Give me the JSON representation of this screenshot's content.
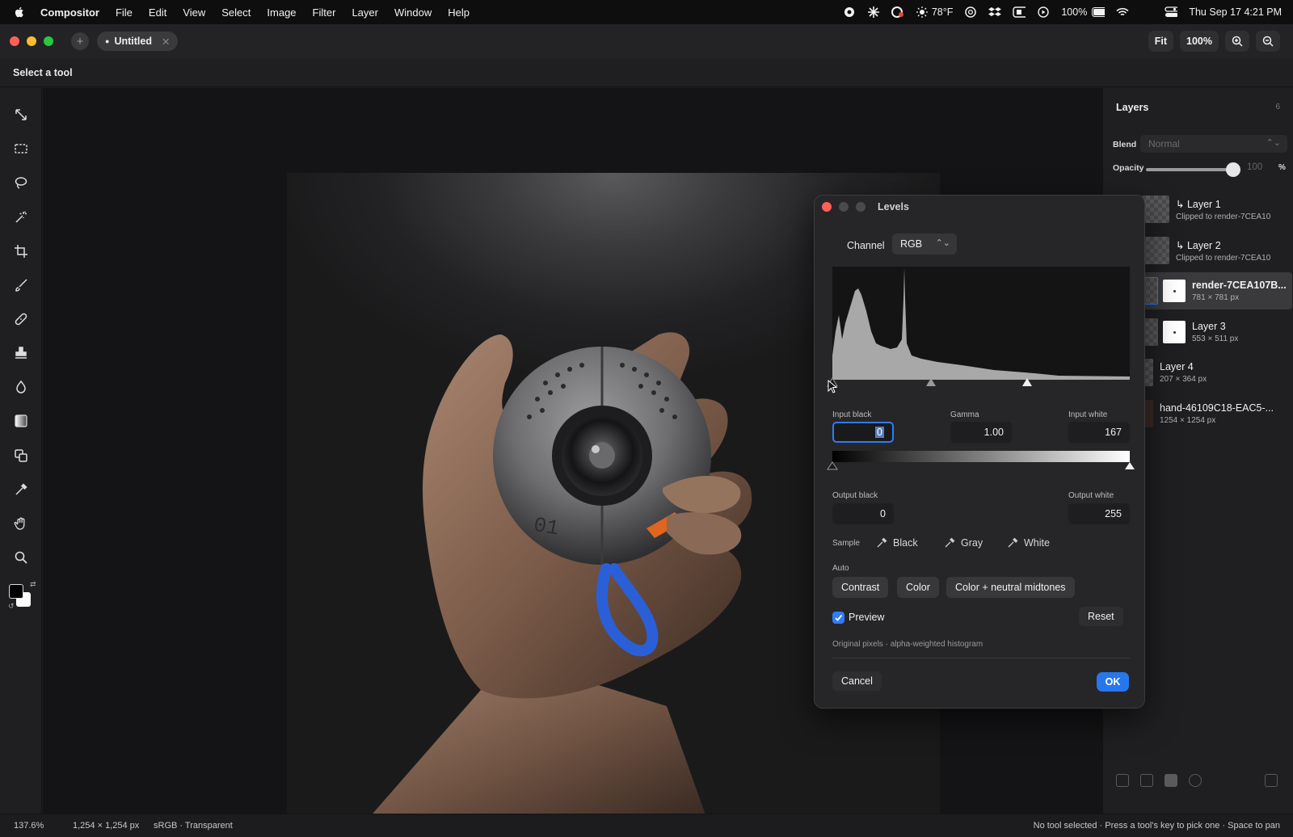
{
  "menubar": {
    "app_name": "Compositor",
    "items": [
      "File",
      "Edit",
      "View",
      "Select",
      "Image",
      "Filter",
      "Layer",
      "Window",
      "Help"
    ],
    "weather": "78°F",
    "battery": "100%",
    "datetime": "Thu Sep 17  4:21 PM"
  },
  "tabbar": {
    "doc_tab": "Untitled",
    "fit_label": "Fit",
    "zoom_label": "100%"
  },
  "options_bar": {
    "hint": "Select a tool"
  },
  "tools": [
    "move-tool",
    "marquee-tool",
    "lasso-tool",
    "magic-wand-tool",
    "crop-tool",
    "brush-tool",
    "healing-tool",
    "stamp-tool",
    "blur-tool",
    "gradient-tool",
    "shape-tool",
    "eyedropper-tool",
    "hand-tool",
    "zoom-tool"
  ],
  "layers_panel": {
    "title": "Layers",
    "count": "6",
    "blend_label": "Blend",
    "blend_value": "Normal",
    "opacity_label": "Opacity",
    "opacity_value": "100",
    "opacity_unit": "%",
    "layers": [
      {
        "name": "Layer 1",
        "sub": "Clipped to render-7CEA10",
        "clipped": true
      },
      {
        "name": "Layer 2",
        "sub": "Clipped to render-7CEA10",
        "clipped": true
      },
      {
        "name": "render-7CEA107B...",
        "sub": "781 × 781 px",
        "selected": true
      },
      {
        "name": "Layer 3",
        "sub": "553 × 511 px"
      },
      {
        "name": "Layer 4",
        "sub": "207 × 364 px"
      },
      {
        "name": "hand-46109C18-EAC5-...",
        "sub": "1254 × 1254 px"
      }
    ]
  },
  "levels_dialog": {
    "title": "Levels",
    "channel_label": "Channel",
    "channel_value": "RGB",
    "input_black_label": "Input black",
    "input_black": "0",
    "gamma_label": "Gamma",
    "gamma": "1.00",
    "input_white_label": "Input white",
    "input_white": "167",
    "output_black_label": "Output black",
    "output_black": "0",
    "output_white_label": "Output white",
    "output_white": "255",
    "sample_label": "Sample",
    "sample_black": "Black",
    "sample_gray": "Gray",
    "sample_white": "White",
    "auto_label": "Auto",
    "auto_contrast": "Contrast",
    "auto_color": "Color",
    "auto_color_neutral": "Color + neutral midtones",
    "preview_label": "Preview",
    "preview_checked": true,
    "reset_label": "Reset",
    "note": "Original pixels · alpha-weighted histogram",
    "cancel_label": "Cancel",
    "ok_label": "OK"
  },
  "statusbar": {
    "zoom": "137.6%",
    "dimensions": "1,254 × 1,254 px",
    "colorspace": "sRGB · Transparent",
    "hint": "No tool selected · Press a tool's key to pick one · Space to pan"
  },
  "colors": {
    "accent": "#2677ec",
    "close": "#ff5f57",
    "minimize": "#febc2e",
    "zoom": "#28c840"
  }
}
